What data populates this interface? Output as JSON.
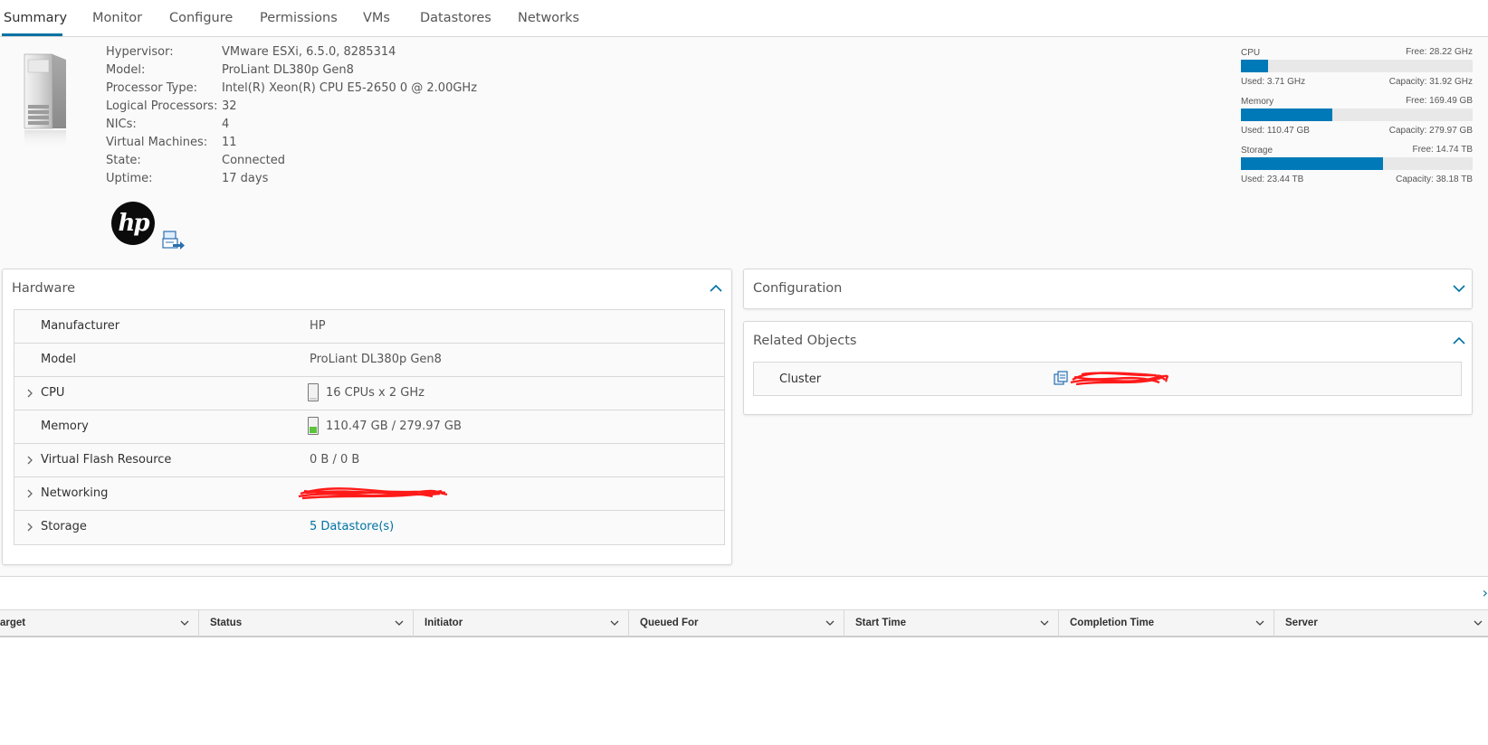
{
  "tabs": [
    {
      "label": "Summary",
      "active": true
    },
    {
      "label": "Monitor"
    },
    {
      "label": "Configure"
    },
    {
      "label": "Permissions"
    },
    {
      "label": "VMs"
    },
    {
      "label": "Datastores"
    },
    {
      "label": "Networks"
    }
  ],
  "host_info": [
    {
      "label": "Hypervisor:",
      "value": "VMware ESXi, 6.5.0, 8285314"
    },
    {
      "label": "Model:",
      "value": "ProLiant DL380p Gen8"
    },
    {
      "label": "Processor Type:",
      "value": "Intel(R) Xeon(R) CPU E5-2650 0 @ 2.00GHz"
    },
    {
      "label": "Logical Processors:",
      "value": "32"
    },
    {
      "label": "NICs:",
      "value": "4"
    },
    {
      "label": "Virtual Machines:",
      "value": "11"
    },
    {
      "label": "State:",
      "value": "Connected"
    },
    {
      "label": "Uptime:",
      "value": "17 days"
    }
  ],
  "vendor_logo_text": "hp",
  "resources": [
    {
      "name": "CPU",
      "free": "Free: 28.22 GHz",
      "used": "Used: 3.71 GHz",
      "capacity": "Capacity: 31.92 GHz",
      "used_fraction": 0.116,
      "color": "#0079b8"
    },
    {
      "name": "Memory",
      "free": "Free: 169.49 GB",
      "used": "Used: 110.47 GB",
      "capacity": "Capacity: 279.97 GB",
      "used_fraction": 0.395,
      "color": "#0079b8"
    },
    {
      "name": "Storage",
      "free": "Free: 14.74 TB",
      "used": "Used: 23.44 TB",
      "capacity": "Capacity: 38.18 TB",
      "used_fraction": 0.614,
      "color": "#0079b8"
    }
  ],
  "hardware": {
    "title": "Hardware",
    "rows": [
      {
        "name": "Manufacturer",
        "value": "HP",
        "expandable": false
      },
      {
        "name": "Model",
        "value": "ProLiant DL380p Gen8",
        "expandable": false
      },
      {
        "name": "CPU",
        "value": "16 CPUs x 2 GHz",
        "expandable": true,
        "icon": "cpu-usage-icon",
        "level": 0.12,
        "level_color": "#cfcfcf"
      },
      {
        "name": "Memory",
        "value": "110.47 GB / 279.97 GB",
        "expandable": false,
        "icon": "memory-usage-icon",
        "level": 0.4,
        "level_color": "#5ac43a"
      },
      {
        "name": "Virtual Flash Resource",
        "value": "0 B / 0 B",
        "expandable": true
      },
      {
        "name": "Networking",
        "value": "",
        "expandable": true,
        "redacted": true
      },
      {
        "name": "Storage",
        "value": "5 Datastore(s)",
        "expandable": true,
        "link": true
      }
    ]
  },
  "configuration": {
    "title": "Configuration"
  },
  "related_objects": {
    "title": "Related Objects",
    "rows": [
      {
        "name": "Cluster",
        "redacted": true
      }
    ]
  },
  "tasks": {
    "columns": [
      "arget",
      "Status",
      "Initiator",
      "Queued For",
      "Start Time",
      "Completion Time",
      "Server"
    ],
    "toggle_glyph": "›"
  }
}
